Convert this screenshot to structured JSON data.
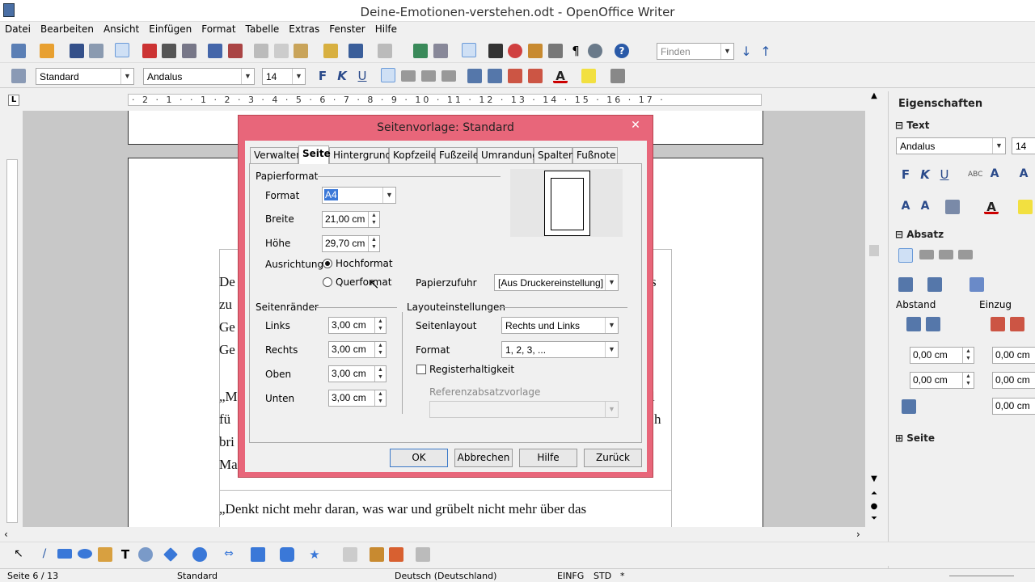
{
  "window": {
    "title": "Deine-Emotionen-verstehen.odt - OpenOffice Writer"
  },
  "menu": [
    "Datei",
    "Bearbeiten",
    "Ansicht",
    "Einfügen",
    "Format",
    "Tabelle",
    "Extras",
    "Fenster",
    "Hilfe"
  ],
  "toolbar": {
    "find_placeholder": "Finden"
  },
  "formatting": {
    "style": "Standard",
    "font": "Andalus",
    "size": "14"
  },
  "document": {
    "lines": [
      "De",
      "zu",
      "Ge",
      "Ge",
      "„M",
      "fü",
      "bri",
      "Ma",
      "„Denkt nicht mehr daran, was war und grübelt nicht mehr über das"
    ],
    "right_fragments": [
      "s",
      "l",
      "h"
    ]
  },
  "dialog": {
    "title": "Seitenvorlage: Standard",
    "tabs": [
      "Verwalten",
      "Seite",
      "Hintergrund",
      "Kopfzeile",
      "Fußzeile",
      "Umrandung",
      "Spalten",
      "Fußnote"
    ],
    "active_tab": "Seite",
    "papierformat": {
      "heading": "Papierformat",
      "format_label": "Format",
      "format_value": "A4",
      "breite_label": "Breite",
      "breite_value": "21,00 cm",
      "hoehe_label": "Höhe",
      "hoehe_value": "29,70 cm",
      "ausrichtung_label": "Ausrichtung",
      "hochformat": "Hochformat",
      "querformat": "Querformat",
      "papierzufuhr_label": "Papierzufuhr",
      "papierzufuhr_value": "[Aus Druckereinstellung]"
    },
    "seitenraender": {
      "heading": "Seitenränder",
      "links_label": "Links",
      "links_value": "3,00 cm",
      "rechts_label": "Rechts",
      "rechts_value": "3,00 cm",
      "oben_label": "Oben",
      "oben_value": "3,00 cm",
      "unten_label": "Unten",
      "unten_value": "3,00 cm"
    },
    "layout": {
      "heading": "Layouteinstellungen",
      "seitenlayout_label": "Seitenlayout",
      "seitenlayout_value": "Rechts und Links",
      "format_label": "Format",
      "format_value": "1, 2, 3, ...",
      "register_label": "Registerhaltigkeit",
      "referenz_label": "Referenzabsatzvorlage"
    },
    "buttons": {
      "ok": "OK",
      "cancel": "Abbrechen",
      "help": "Hilfe",
      "back": "Zurück"
    }
  },
  "sidebar": {
    "title": "Eigenschaften",
    "text_section": "Text",
    "font": "Andalus",
    "size": "14",
    "absatz_section": "Absatz",
    "abstand_label": "Abstand",
    "einzug_label": "Einzug",
    "abstand_oben": "0,00 cm",
    "abstand_unten": "0,00 cm",
    "einzug_vor": "0,00 cm",
    "einzug_nach": "0,00 cm",
    "einzug_erste": "0,00 cm",
    "seite_section": "Seite"
  },
  "ruler": {
    "text": "· 2 · 1 · · 1 · 2 · 3 · 4 · 5 · 6 · 7 · 8 · 9 · 10 · 11 · 12 · 13 · 14 · 15 · 16 · 17 ·"
  },
  "status": {
    "page": "Seite 6 / 13",
    "style": "Standard",
    "language": "Deutsch (Deutschland)",
    "mode": "EINFG",
    "sel": "STD",
    "modified": "*"
  }
}
